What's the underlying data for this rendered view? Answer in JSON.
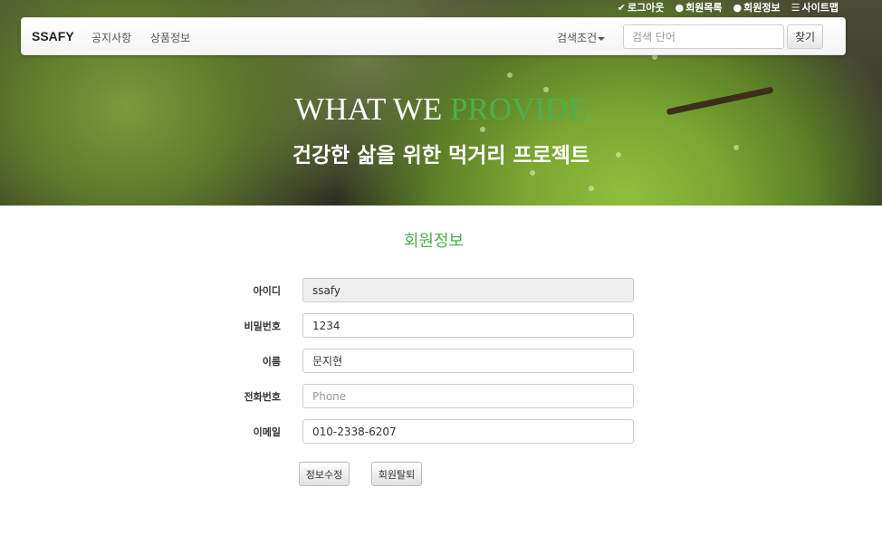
{
  "util_links": [
    {
      "icon": "check-icon",
      "glyph": "✔",
      "label": "로그아웃"
    },
    {
      "icon": "user-icon",
      "glyph": "👤",
      "label": "회원목록"
    },
    {
      "icon": "user-icon",
      "glyph": "👤",
      "label": "회원정보"
    },
    {
      "icon": "list-icon",
      "glyph": "☰",
      "label": "사이트맵"
    }
  ],
  "navbar": {
    "brand": "SSAFY",
    "links": [
      "공지사항",
      "상품정보"
    ],
    "search_condition": "검색조건",
    "search_placeholder": "검색 단어",
    "search_button": "찾기"
  },
  "hero": {
    "title_part1": "WHAT WE ",
    "title_part2": "PROVIDE",
    "subtitle": "건강한 삶을 위한 먹거리 프로젝트"
  },
  "form": {
    "title": "회원정보",
    "fields": [
      {
        "label": "아이디",
        "value": "ssafy",
        "placeholder": ""
      },
      {
        "label": "비밀번호",
        "value": "1234",
        "placeholder": ""
      },
      {
        "label": "이름",
        "value": "문지현",
        "placeholder": ""
      },
      {
        "label": "전화번호",
        "value": "",
        "placeholder": "Phone"
      },
      {
        "label": "이메일",
        "value": "010-2338-6207",
        "placeholder": ""
      }
    ],
    "update_button": "정보수정",
    "withdraw_button": "회원탈퇴"
  },
  "colors": {
    "accent": "#4caf50"
  }
}
